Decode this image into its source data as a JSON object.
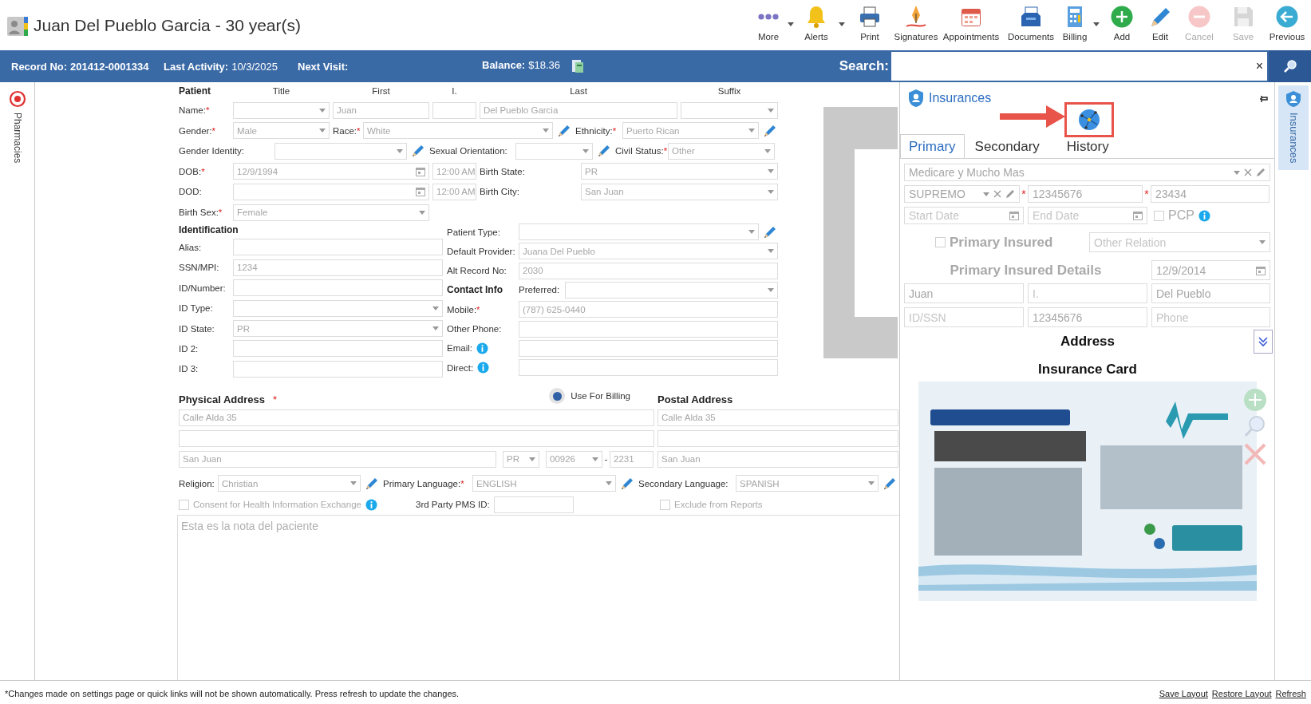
{
  "header": {
    "title": "Juan Del Pueblo Garcia - 30 year(s)",
    "toolbar": [
      {
        "kind": "more",
        "label": "More",
        "menu": true,
        "disabled": false
      },
      {
        "kind": "alerts",
        "label": "Alerts",
        "menu": true,
        "disabled": false
      },
      {
        "kind": "print",
        "label": "Print",
        "menu": false,
        "disabled": false
      },
      {
        "kind": "signatures",
        "label": "Signatures",
        "menu": false,
        "disabled": false
      },
      {
        "kind": "appointments",
        "label": "Appointments",
        "menu": false,
        "disabled": false
      },
      {
        "kind": "documents",
        "label": "Documents",
        "menu": false,
        "disabled": false
      },
      {
        "kind": "billing",
        "label": "Billing",
        "menu": true,
        "disabled": false
      },
      {
        "kind": "add",
        "label": "Add",
        "menu": false,
        "disabled": false
      },
      {
        "kind": "edit",
        "label": "Edit",
        "menu": false,
        "disabled": false
      },
      {
        "kind": "cancel",
        "label": "Cancel",
        "menu": false,
        "disabled": true
      },
      {
        "kind": "save",
        "label": "Save",
        "menu": false,
        "disabled": true
      },
      {
        "kind": "previous",
        "label": "Previous",
        "menu": false,
        "disabled": false
      }
    ]
  },
  "record_bar": {
    "record_label": "Record No:",
    "record_number": "201412-0001334",
    "last_activity_label": "Last Activity:",
    "last_activity": "10/3/2025",
    "next_visit_label": "Next Visit:",
    "balance_label": "Balance:",
    "balance": "$18.36",
    "search_label": "Search:",
    "clear": "×"
  },
  "side_tabs": {
    "left": "Pharmacies",
    "right": "Insurances"
  },
  "patient": {
    "title": "Patient",
    "column_headers": [
      "Title",
      "First",
      "I.",
      "Last",
      "Suffix"
    ],
    "rows": [
      [
        {
          "kind": "label",
          "text": "Name:",
          "required_mark": "*"
        },
        {
          "kind": "select"
        },
        {
          "kind": "input",
          "value": "Juan"
        },
        {
          "kind": "input"
        },
        {
          "kind": "input",
          "value": "Del Pueblo Garcia"
        },
        {
          "kind": "select"
        }
      ],
      [
        {
          "kind": "label",
          "text": "Gender:",
          "required_mark": "*"
        },
        {
          "kind": "select",
          "value": "Male"
        },
        {
          "kind": "label",
          "text": "Race:",
          "required_mark": "*"
        },
        {
          "kind": "select",
          "value": "White"
        },
        {
          "kind": "edit"
        },
        {
          "kind": "label",
          "text": "Ethnicity:",
          "required_mark": "*"
        },
        {
          "kind": "select",
          "value": "Puerto Rican"
        },
        {
          "kind": "edit"
        }
      ],
      [
        {
          "kind": "label",
          "text": "Gender Identity:"
        },
        {
          "kind": "select"
        },
        {
          "kind": "edit"
        },
        {
          "kind": "label",
          "text": "Sexual Orientation:"
        },
        {
          "kind": "select"
        },
        {
          "kind": "edit"
        },
        {
          "kind": "label",
          "text": "Civil Status:",
          "required_mark": "*"
        },
        {
          "kind": "select",
          "value": "Other"
        }
      ],
      [
        {
          "kind": "label",
          "text": "DOB:",
          "required_mark": "*"
        },
        {
          "kind": "date",
          "value": "12/9/1994"
        },
        {
          "kind": "time",
          "value": "12:00 AM"
        },
        {
          "kind": "label",
          "text": "Birth State:"
        },
        {
          "kind": "select",
          "value": "PR"
        }
      ],
      [
        {
          "kind": "label",
          "text": "DOD:"
        },
        {
          "kind": "date"
        },
        {
          "kind": "time",
          "value": "12:00 AM"
        },
        {
          "kind": "label",
          "text": "Birth City:"
        },
        {
          "kind": "select",
          "value": "San Juan"
        }
      ],
      [
        {
          "kind": "label",
          "text": "Birth Sex:",
          "required_mark": "*"
        },
        {
          "kind": "select",
          "value": "Female"
        }
      ]
    ]
  },
  "identification": {
    "left": [
      [
        {
          "kind": "heading",
          "text": "Identification"
        }
      ],
      [
        {
          "kind": "label",
          "text": "Alias:"
        },
        {
          "kind": "input"
        }
      ],
      [
        {
          "kind": "label",
          "text": "SSN/MPI:"
        },
        {
          "kind": "input",
          "value": "1234"
        }
      ],
      [
        {
          "kind": "label",
          "text": "ID/Number:"
        },
        {
          "kind": "input"
        }
      ],
      [
        {
          "kind": "label",
          "text": "ID Type:"
        },
        {
          "kind": "select"
        }
      ],
      [
        {
          "kind": "label",
          "text": "ID State:"
        },
        {
          "kind": "select",
          "value": "PR"
        }
      ],
      [
        {
          "kind": "label",
          "text": "ID 2:"
        },
        {
          "kind": "input"
        }
      ],
      [
        {
          "kind": "label",
          "text": "ID 3:"
        },
        {
          "kind": "input"
        }
      ]
    ],
    "right": [
      [
        {
          "kind": "label",
          "text": "Patient Type:"
        },
        {
          "kind": "select"
        },
        {
          "kind": "edit"
        }
      ],
      [
        {
          "kind": "label",
          "text": "Default Provider:"
        },
        {
          "kind": "select",
          "value": "Juana Del Pueblo"
        }
      ],
      [
        {
          "kind": "label",
          "text": "Alt Record No:"
        },
        {
          "kind": "input",
          "value": "2030"
        }
      ],
      [
        {
          "kind": "heading",
          "text": "Contact Info"
        },
        {
          "kind": "label",
          "text": "Preferred:"
        },
        {
          "kind": "select"
        }
      ],
      [
        {
          "kind": "label",
          "text": "Mobile:",
          "required_mark": "*"
        },
        {
          "kind": "input",
          "value": "(787) 625-0440"
        }
      ],
      [
        {
          "kind": "label",
          "text": "Other Phone:"
        },
        {
          "kind": "input"
        }
      ],
      [
        {
          "kind": "label",
          "text": "Email:",
          "info": true
        },
        {
          "kind": "input"
        }
      ],
      [
        {
          "kind": "label",
          "text": "Direct:",
          "info": true
        },
        {
          "kind": "input"
        }
      ]
    ]
  },
  "address": {
    "physical": {
      "title": "Physical Address",
      "required_mark": "*",
      "line_1": "Calle Alda 35",
      "city": "San Juan",
      "state": "PR",
      "zip": "00926",
      "zip_separator": "-",
      "zip_extension": "2231"
    },
    "use_for_billing": {
      "label": "Use For Billing",
      "selected": true
    },
    "postal": {
      "title": "Postal Address",
      "line_1": "Calle Alda 35",
      "city": "San Juan"
    }
  },
  "more_rows": [
    [
      {
        "kind": "label",
        "text": "Religion:"
      },
      {
        "kind": "select",
        "value": "Christian"
      },
      {
        "kind": "edit"
      },
      {
        "kind": "label",
        "text": "Primary Language:",
        "required_mark": "*"
      },
      {
        "kind": "select",
        "value": "ENGLISH"
      },
      {
        "kind": "edit"
      },
      {
        "kind": "label",
        "text": "Secondary Language:"
      },
      {
        "kind": "select",
        "value": "SPANISH"
      },
      {
        "kind": "edit"
      }
    ],
    [
      {
        "kind": "check",
        "label": "Consent for Health Information Exchange",
        "checked": false,
        "info": true
      },
      {
        "kind": "label",
        "text": "3rd Party PMS ID:"
      },
      {
        "kind": "input"
      },
      {
        "kind": "check",
        "label": "Exclude from Reports",
        "checked": false
      }
    ]
  ],
  "notes": {
    "placeholder": "Esta es la nota del paciente"
  },
  "insurances": {
    "title": "Insurances",
    "tabs": [
      {
        "label": "Primary",
        "selected": true
      },
      {
        "label": "Secondary",
        "selected": false
      },
      {
        "label": "History",
        "selected": false
      }
    ],
    "plan": {
      "value": "Medicare y Mucho Mas"
    },
    "product": {
      "value": "SUPREMO"
    },
    "member_id": {
      "value": "12345676",
      "required_mark": "*"
    },
    "group_number": {
      "value": "23434",
      "required_mark": "*"
    },
    "start_date": {
      "placeholder": "Start Date"
    },
    "end_date": {
      "placeholder": "End Date"
    },
    "pcp": {
      "label": "PCP",
      "checked": false
    },
    "primary_insured": {
      "label": "Primary Insured",
      "checked": false
    },
    "relation": {
      "placeholder": "Other Relation"
    },
    "details_title": "Primary Insured Details",
    "insured_dob": {
      "value": "12/9/2014"
    },
    "insured_fields": [
      {
        "value": "Juan"
      },
      {
        "placeholder": "I."
      },
      {
        "value": "Del Pueblo"
      },
      {
        "placeholder": "ID/SSN"
      },
      {
        "value": "12345676"
      },
      {
        "placeholder": "Phone"
      }
    ],
    "address": {
      "title": "Address",
      "expanded": false
    },
    "card_title": "Insurance Card"
  },
  "footer": {
    "note": "*Changes made on settings page or quick links will not be shown automatically. Press refresh to update the changes.",
    "links": [
      "Save Layout",
      "Restore Layout",
      "Refresh"
    ]
  }
}
